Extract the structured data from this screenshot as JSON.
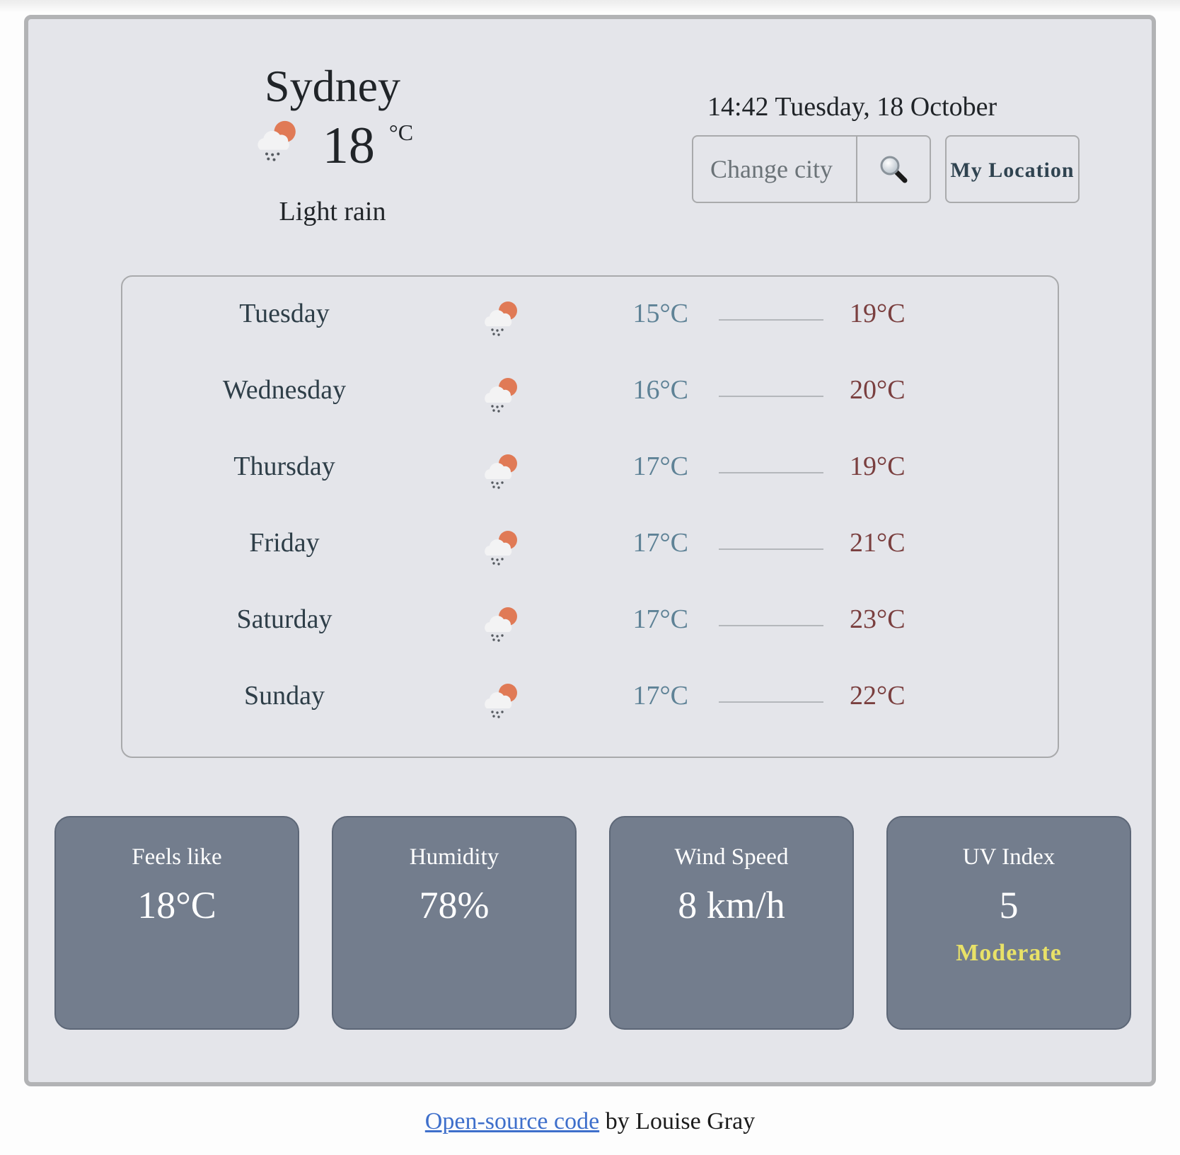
{
  "current": {
    "city": "Sydney",
    "temperature": "18",
    "unit": "°C",
    "icon": "light-rain-sun-cloud-icon",
    "description": "Light rain"
  },
  "header": {
    "datetime": "14:42 Tuesday, 18 October"
  },
  "search": {
    "placeholder": "Change city",
    "value": "",
    "button_icon": "magnifying-glass-icon",
    "location_button_label": "My Location"
  },
  "forecast": [
    {
      "day": "Tuesday",
      "icon": "light-rain-sun-cloud-icon",
      "min": "15°C",
      "max": "19°C"
    },
    {
      "day": "Wednesday",
      "icon": "light-rain-sun-cloud-icon",
      "min": "16°C",
      "max": "20°C"
    },
    {
      "day": "Thursday",
      "icon": "light-rain-sun-cloud-icon",
      "min": "17°C",
      "max": "19°C"
    },
    {
      "day": "Friday",
      "icon": "light-rain-sun-cloud-icon",
      "min": "17°C",
      "max": "21°C"
    },
    {
      "day": "Saturday",
      "icon": "light-rain-sun-cloud-icon",
      "min": "17°C",
      "max": "23°C"
    },
    {
      "day": "Sunday",
      "icon": "light-rain-sun-cloud-icon",
      "min": "17°C",
      "max": "22°C"
    }
  ],
  "details": [
    {
      "title": "Feels like",
      "value": "18°C"
    },
    {
      "title": "Humidity",
      "value": "78%"
    },
    {
      "title": "Wind Speed",
      "value": "8 km/h"
    },
    {
      "title": "UV Index",
      "value": "5",
      "level": "Moderate"
    }
  ],
  "footer": {
    "link_text": "Open-source code",
    "suffix": " by Louise Gray"
  },
  "colors": {
    "background": "#e4e5ea",
    "min_temp": "#5e8296",
    "max_temp": "#7a3f3f",
    "card_bg": "#737d8d",
    "uv_moderate": "#e8e168",
    "link": "#3e6fcb"
  }
}
